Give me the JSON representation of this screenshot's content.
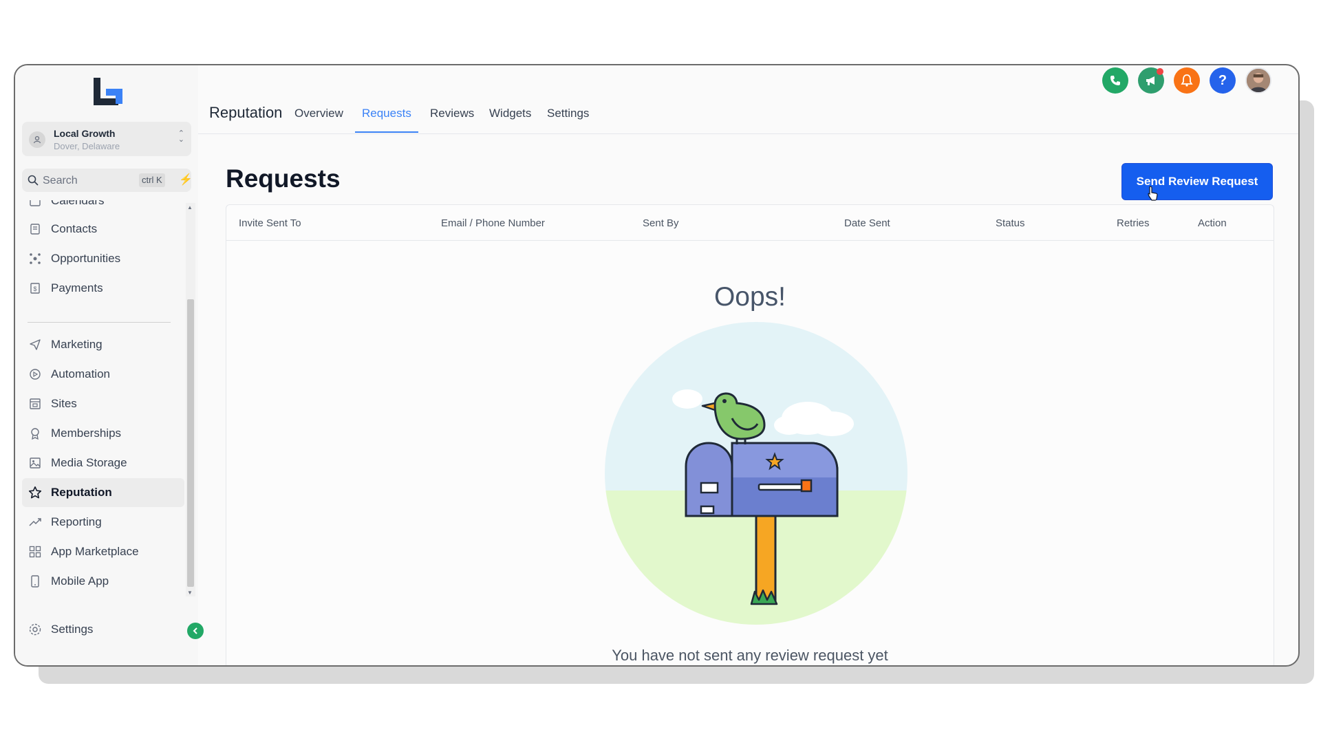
{
  "account": {
    "name": "Local Growth",
    "location": "Dover, Delaware"
  },
  "search": {
    "placeholder": "Search",
    "shortcut": "ctrl K"
  },
  "sidebar": {
    "items": [
      {
        "label": "Calendars",
        "icon": "calendar-icon"
      },
      {
        "label": "Contacts",
        "icon": "contacts-icon"
      },
      {
        "label": "Opportunities",
        "icon": "opportunities-icon"
      },
      {
        "label": "Payments",
        "icon": "payments-icon"
      },
      {
        "label": "Marketing",
        "icon": "send-icon"
      },
      {
        "label": "Automation",
        "icon": "automation-icon"
      },
      {
        "label": "Sites",
        "icon": "sites-icon"
      },
      {
        "label": "Memberships",
        "icon": "award-icon"
      },
      {
        "label": "Media Storage",
        "icon": "image-icon"
      },
      {
        "label": "Reputation",
        "icon": "star-icon",
        "active": true
      },
      {
        "label": "Reporting",
        "icon": "trend-icon"
      },
      {
        "label": "App Marketplace",
        "icon": "grid-icon"
      },
      {
        "label": "Mobile App",
        "icon": "mobile-icon"
      }
    ],
    "settings_label": "Settings"
  },
  "header": {
    "title": "Reputation",
    "tabs": [
      {
        "label": "Overview"
      },
      {
        "label": "Requests",
        "active": true
      },
      {
        "label": "Reviews"
      },
      {
        "label": "Widgets"
      },
      {
        "label": "Settings"
      }
    ],
    "icons": [
      "phone-icon",
      "megaphone-icon",
      "bell-icon",
      "help-icon",
      "avatar"
    ],
    "help_glyph": "?"
  },
  "page": {
    "title": "Requests",
    "primary_button": "Send Review Request"
  },
  "table": {
    "columns": [
      "Invite Sent To",
      "Email / Phone Number",
      "Sent By",
      "Date Sent",
      "Status",
      "Retries",
      "Action"
    ]
  },
  "empty_state": {
    "heading": "Oops!",
    "message": "You have not sent any review request yet"
  },
  "colors": {
    "accent": "#155eef",
    "tab_active": "#3b82f6",
    "phone": "#22a866",
    "megaphone": "#2f9e6e",
    "bell": "#f97316",
    "help": "#2563eb"
  }
}
